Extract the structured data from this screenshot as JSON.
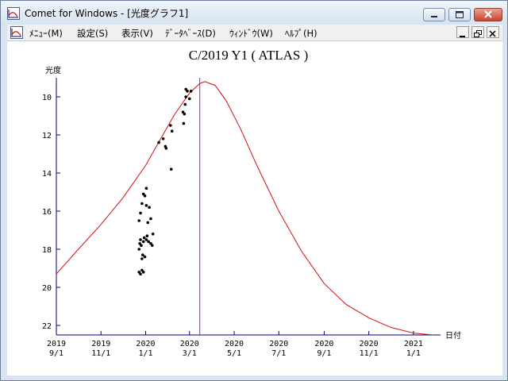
{
  "window": {
    "title": "Comet for Windows - [光度グラフ1]"
  },
  "menu": {
    "items": [
      {
        "label": "ﾒﾆｭｰ(M)"
      },
      {
        "label": "設定(S)"
      },
      {
        "label": "表示(V)"
      },
      {
        "label": "ﾃﾞｰﾀﾍﾞｰｽ(D)"
      },
      {
        "label": "ｳｨﾝﾄﾞｳ(W)"
      },
      {
        "label": "ﾍﾙﾌﾟ(H)"
      }
    ]
  },
  "colors": {
    "curve": "#d01010",
    "perihelion_line": "#9a27c6",
    "axis": "#000080",
    "points": "#000000"
  },
  "chart_data": {
    "type": "scatter",
    "title": "C/2019 Y1 ( ATLAS )",
    "ylabel": "光度",
    "xlabel": "日付",
    "y_inverted": true,
    "xlim": [
      "2019-09-01",
      "2021-02-07"
    ],
    "ylim": [
      22.5,
      9.0
    ],
    "y_ticks": [
      10,
      12,
      14,
      16,
      18,
      20,
      22
    ],
    "x_ticks": [
      {
        "year": "2019",
        "md": "9/1",
        "date": "2019-09-01"
      },
      {
        "year": "2019",
        "md": "11/1",
        "date": "2019-11-01"
      },
      {
        "year": "2020",
        "md": "1/1",
        "date": "2020-01-01"
      },
      {
        "year": "2020",
        "md": "3/1",
        "date": "2020-03-01"
      },
      {
        "year": "2020",
        "md": "5/1",
        "date": "2020-05-01"
      },
      {
        "year": "2020",
        "md": "7/1",
        "date": "2020-07-01"
      },
      {
        "year": "2020",
        "md": "9/1",
        "date": "2020-09-01"
      },
      {
        "year": "2020",
        "md": "11/1",
        "date": "2020-11-01"
      },
      {
        "year": "2021",
        "md": "1/1",
        "date": "2021-01-01"
      }
    ],
    "perihelion_date": "2020-03-15",
    "predicted_curve": [
      {
        "x": "2019-09-01",
        "y": 19.3
      },
      {
        "x": "2019-10-01",
        "y": 18.0
      },
      {
        "x": "2019-11-01",
        "y": 16.7
      },
      {
        "x": "2019-12-01",
        "y": 15.3
      },
      {
        "x": "2020-01-01",
        "y": 13.6
      },
      {
        "x": "2020-01-20",
        "y": 12.3
      },
      {
        "x": "2020-02-10",
        "y": 10.9
      },
      {
        "x": "2020-03-01",
        "y": 9.8
      },
      {
        "x": "2020-03-15",
        "y": 9.3
      },
      {
        "x": "2020-03-22",
        "y": 9.2
      },
      {
        "x": "2020-04-05",
        "y": 9.4
      },
      {
        "x": "2020-04-20",
        "y": 10.2
      },
      {
        "x": "2020-05-10",
        "y": 11.7
      },
      {
        "x": "2020-06-01",
        "y": 13.6
      },
      {
        "x": "2020-07-01",
        "y": 16.0
      },
      {
        "x": "2020-08-01",
        "y": 18.1
      },
      {
        "x": "2020-09-01",
        "y": 19.8
      },
      {
        "x": "2020-10-01",
        "y": 20.9
      },
      {
        "x": "2020-11-01",
        "y": 21.6
      },
      {
        "x": "2020-12-01",
        "y": 22.1
      },
      {
        "x": "2021-01-01",
        "y": 22.4
      },
      {
        "x": "2021-01-28",
        "y": 22.5
      }
    ],
    "observations": [
      {
        "x": "2019-12-23",
        "y": 19.2
      },
      {
        "x": "2019-12-25",
        "y": 19.3
      },
      {
        "x": "2019-12-27",
        "y": 19.1
      },
      {
        "x": "2019-12-29",
        "y": 19.2
      },
      {
        "x": "2019-12-23",
        "y": 18.0
      },
      {
        "x": "2019-12-24",
        "y": 17.7
      },
      {
        "x": "2019-12-25",
        "y": 17.5
      },
      {
        "x": "2019-12-26",
        "y": 17.8
      },
      {
        "x": "2019-12-27",
        "y": 18.5
      },
      {
        "x": "2019-12-28",
        "y": 18.3
      },
      {
        "x": "2019-12-29",
        "y": 17.6
      },
      {
        "x": "2019-12-30",
        "y": 17.4
      },
      {
        "x": "2019-12-31",
        "y": 18.4
      },
      {
        "x": "2020-01-02",
        "y": 17.5
      },
      {
        "x": "2020-01-03",
        "y": 17.3
      },
      {
        "x": "2020-01-05",
        "y": 17.6
      },
      {
        "x": "2020-01-08",
        "y": 17.7
      },
      {
        "x": "2020-01-10",
        "y": 17.8
      },
      {
        "x": "2020-01-11",
        "y": 17.2
      },
      {
        "x": "2019-12-23",
        "y": 16.5
      },
      {
        "x": "2019-12-25",
        "y": 16.1
      },
      {
        "x": "2019-12-27",
        "y": 15.6
      },
      {
        "x": "2019-12-29",
        "y": 15.1
      },
      {
        "x": "2019-12-31",
        "y": 15.2
      },
      {
        "x": "2020-01-02",
        "y": 14.8
      },
      {
        "x": "2020-01-02",
        "y": 15.7
      },
      {
        "x": "2020-01-04",
        "y": 16.6
      },
      {
        "x": "2020-01-06",
        "y": 15.8
      },
      {
        "x": "2020-01-08",
        "y": 16.4
      },
      {
        "x": "2020-01-19",
        "y": 12.4
      },
      {
        "x": "2020-01-25",
        "y": 12.2
      },
      {
        "x": "2020-01-28",
        "y": 12.6
      },
      {
        "x": "2020-01-29",
        "y": 12.7
      },
      {
        "x": "2020-02-04",
        "y": 11.5
      },
      {
        "x": "2020-02-06",
        "y": 11.8
      },
      {
        "x": "2020-02-05",
        "y": 13.8
      },
      {
        "x": "2020-02-21",
        "y": 10.8
      },
      {
        "x": "2020-02-23",
        "y": 10.9
      },
      {
        "x": "2020-02-22",
        "y": 11.4
      },
      {
        "x": "2020-02-24",
        "y": 10.4
      },
      {
        "x": "2020-02-25",
        "y": 10.0
      },
      {
        "x": "2020-02-25",
        "y": 9.6
      },
      {
        "x": "2020-02-27",
        "y": 9.7
      },
      {
        "x": "2020-03-01",
        "y": 10.1
      },
      {
        "x": "2020-03-03",
        "y": 9.7
      }
    ]
  }
}
